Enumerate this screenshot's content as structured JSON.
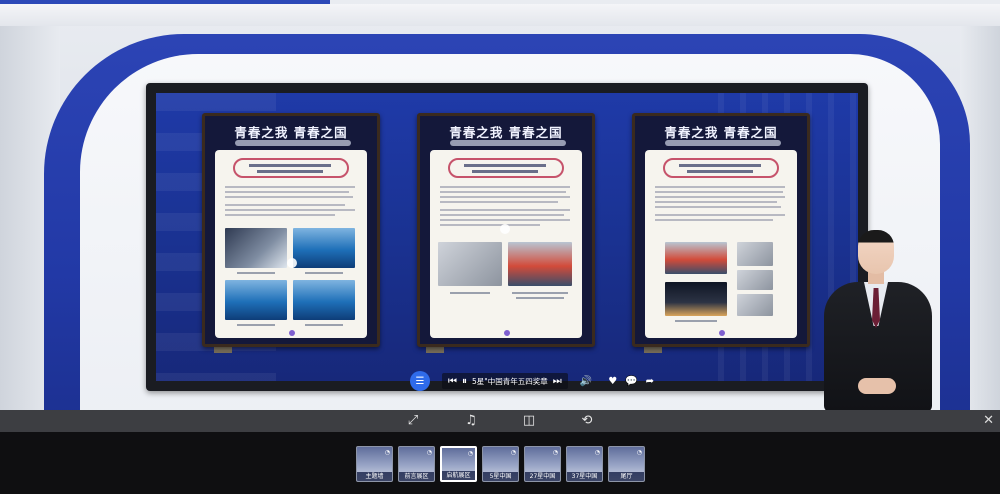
{
  "exhibit": {
    "poster_title": "青春之我 青春之国",
    "posters": [
      {
        "id": "poster-1"
      },
      {
        "id": "poster-2"
      },
      {
        "id": "poster-3"
      }
    ]
  },
  "player": {
    "track_title": "5星\"中国青年五四奖章",
    "menu_icon": "list-icon",
    "prev_icon": "skip-previous-icon",
    "pause_icon": "pause-icon",
    "next_icon": "skip-next-icon",
    "volume_icon": "volume-icon",
    "like_icon": "heart-icon",
    "comment_icon": "comment-icon",
    "share_icon": "share-icon"
  },
  "toolbar": {
    "items": [
      {
        "name": "fullscreen",
        "glyph": "⤢"
      },
      {
        "name": "music",
        "glyph": "♫"
      },
      {
        "name": "vr",
        "glyph": "◫"
      },
      {
        "name": "gyro",
        "glyph": "⟲"
      }
    ],
    "close_glyph": "✕"
  },
  "scenes": {
    "items": [
      {
        "label": "主题墙",
        "active": false
      },
      {
        "label": "前言展区",
        "active": false
      },
      {
        "label": "启航展区",
        "active": true
      },
      {
        "label": "5星中国",
        "active": false
      },
      {
        "label": "27星中国",
        "active": false
      },
      {
        "label": "37星中国",
        "active": false
      },
      {
        "label": "尾厅",
        "active": false
      }
    ]
  },
  "colors": {
    "arch_blue": "#2239a6",
    "accent_blue": "#2f6bea",
    "poster_pill": "#c6536b"
  }
}
